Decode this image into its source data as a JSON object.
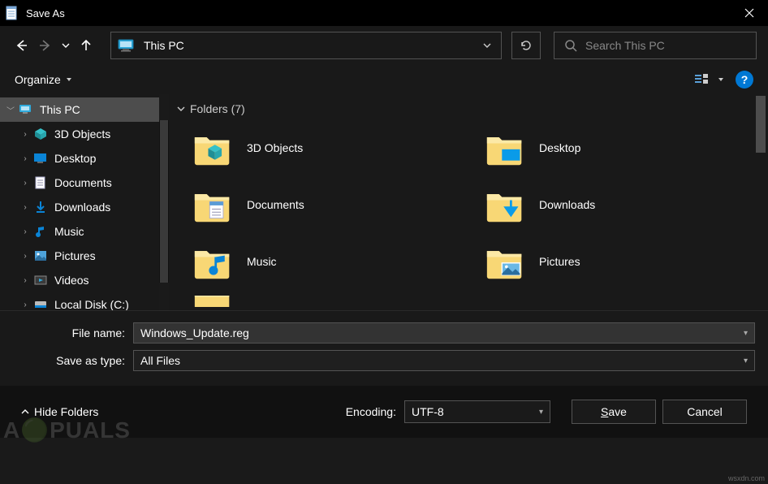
{
  "titlebar": {
    "title": "Save As"
  },
  "nav": {
    "path_icon": "pc",
    "path": "This PC"
  },
  "search": {
    "placeholder": "Search This PC"
  },
  "toolbar": {
    "organize": "Organize"
  },
  "sidebar": {
    "items": [
      {
        "label": "This PC",
        "icon": "pc",
        "selected": true,
        "expanded": true
      },
      {
        "label": "3D Objects",
        "icon": "3d",
        "selected": false,
        "expanded": false
      },
      {
        "label": "Desktop",
        "icon": "desktop",
        "selected": false,
        "expanded": false
      },
      {
        "label": "Documents",
        "icon": "documents",
        "selected": false,
        "expanded": false
      },
      {
        "label": "Downloads",
        "icon": "downloads",
        "selected": false,
        "expanded": false
      },
      {
        "label": "Music",
        "icon": "music",
        "selected": false,
        "expanded": false
      },
      {
        "label": "Pictures",
        "icon": "pictures",
        "selected": false,
        "expanded": false
      },
      {
        "label": "Videos",
        "icon": "videos",
        "selected": false,
        "expanded": false
      },
      {
        "label": "Local Disk (C:)",
        "icon": "disk",
        "selected": false,
        "expanded": false
      }
    ]
  },
  "content": {
    "group_header": "Folders (7)",
    "folders": [
      {
        "name": "3D Objects",
        "icon": "3d"
      },
      {
        "name": "Desktop",
        "icon": "desktop"
      },
      {
        "name": "Documents",
        "icon": "documents"
      },
      {
        "name": "Downloads",
        "icon": "downloads"
      },
      {
        "name": "Music",
        "icon": "music"
      },
      {
        "name": "Pictures",
        "icon": "pictures"
      }
    ]
  },
  "form": {
    "filename_label": "File name:",
    "filename_value": "Windows_Update.reg",
    "filetype_label": "Save as type:",
    "filetype_value": "All Files",
    "encoding_label": "Encoding:",
    "encoding_value": "UTF-8",
    "hide_folders": "Hide Folders",
    "save": "Save",
    "cancel": "Cancel"
  },
  "colors": {
    "accent": "#0078d4",
    "folder": "#f8d775",
    "bg": "#191919",
    "border": "#535353"
  }
}
